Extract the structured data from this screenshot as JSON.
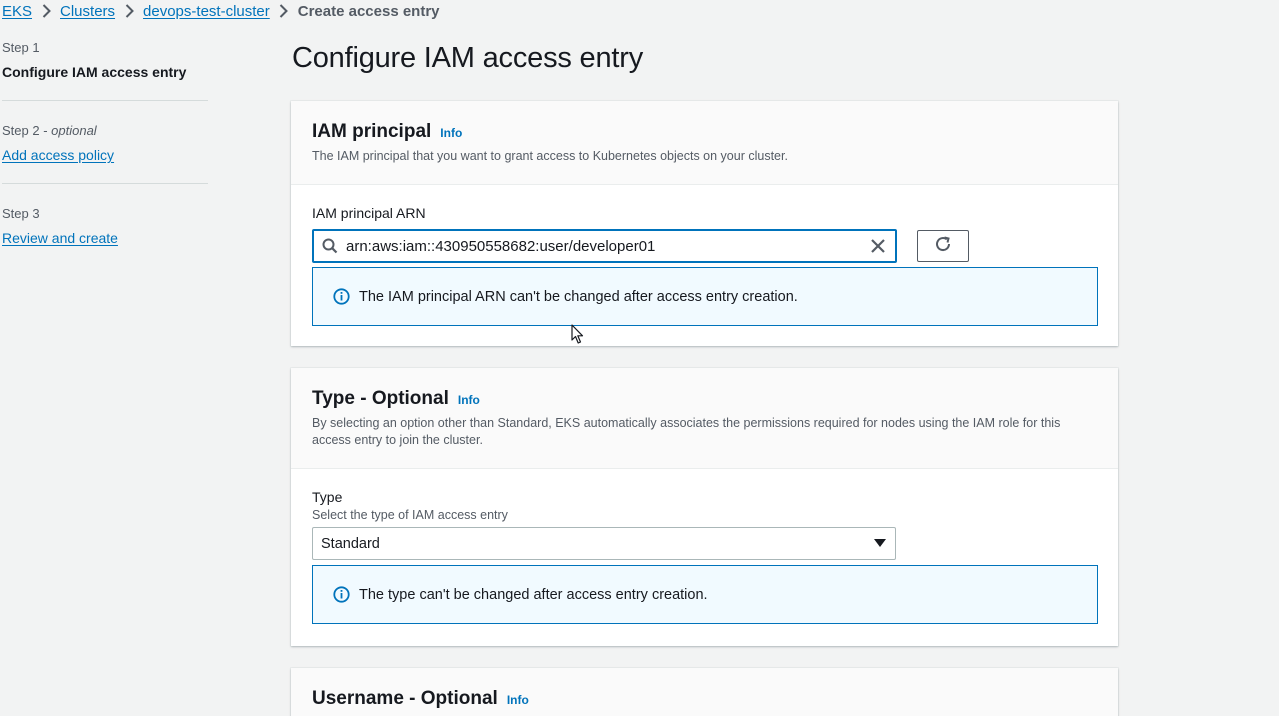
{
  "breadcrumb": {
    "items": [
      "EKS",
      "Clusters",
      "devops-test-cluster"
    ],
    "current": "Create access entry"
  },
  "steps": [
    {
      "num": "Step 1",
      "optional": "",
      "label": "Configure IAM access entry"
    },
    {
      "num": "Step 2 -",
      "optional": "optional",
      "label": "Add access policy"
    },
    {
      "num": "Step 3",
      "optional": "",
      "label": "Review and create"
    }
  ],
  "page_title": "Configure IAM access entry",
  "iam_principal": {
    "title": "IAM principal",
    "info": "Info",
    "description": "The IAM principal that you want to grant access to Kubernetes objects on your cluster.",
    "arn_label": "IAM principal ARN",
    "arn_value": "arn:aws:iam::430950558682:user/developer01",
    "alert": "The IAM principal ARN can't be changed after access entry creation."
  },
  "type_section": {
    "title": "Type - Optional",
    "info": "Info",
    "description": "By selecting an option other than Standard, EKS automatically associates the permissions required for nodes using the IAM role for this access entry to join the cluster.",
    "field_label": "Type",
    "field_sublabel": "Select the type of IAM access entry",
    "selected": "Standard",
    "alert": "The type can't be changed after access entry creation."
  },
  "username_section": {
    "title": "Username - Optional",
    "info": "Info"
  },
  "colors": {
    "link": "#0073bb",
    "alert_bg": "#f1faff",
    "page_bg": "#f2f3f3"
  }
}
